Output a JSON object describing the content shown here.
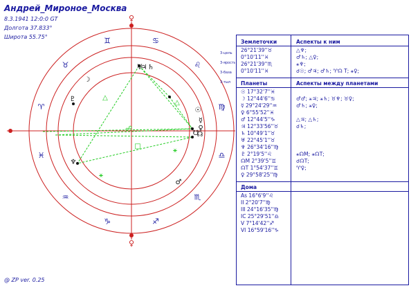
{
  "header": {
    "name": "Андрей_Мироное_Москва",
    "datetime": "8.3.1941 12:0:0 GT",
    "longitude": "Долгота 37.833°",
    "latitude": "Широта 55.75°"
  },
  "footer": {
    "version": "@ ZP  ver. 0.25"
  },
  "wheel": {
    "signs": [
      "♈",
      "♉",
      "♊",
      "♋",
      "♌",
      "♍",
      "♎",
      "♏",
      "♐",
      "♑",
      "♒",
      "♓"
    ],
    "side_labels": [
      "3-цель",
      "3-ярость",
      "3-база",
      "3-тыл"
    ],
    "planet_glyphs": [
      "☉",
      "☽",
      "☿",
      "♀",
      "♂",
      "♃",
      "♄",
      "♅",
      "♆",
      "♇",
      "☊",
      "☋"
    ],
    "aspect_marks": [
      "△",
      "☍",
      "□",
      "⚹",
      "△",
      "⚹"
    ],
    "colors": {
      "ring": "#cc2020",
      "axis": "#cc2020",
      "aspect": "#22cc22",
      "ink": "#1a1aa0"
    }
  },
  "table": {
    "header1": [
      "Землеточки",
      "Аспекты к ним"
    ],
    "points": [
      {
        "pos": "26°21'39''♉",
        "asp": "△♆;"
      },
      {
        "pos": "0°10'11''♓",
        "asp": "♂♄; △♀;"
      },
      {
        "pos": "26°21'39''♏",
        "asp": "⚹♆;"
      },
      {
        "pos": "0°10'11''♓",
        "asp": "☌☉; ♂♃; ♂♄; ♈☊ T; ⚹♀;"
      }
    ],
    "header2": [
      "Планеты",
      "Аспекты между планетами"
    ],
    "planets": [
      {
        "pos": "☉ 17°32'7''♓",
        "asp": ""
      },
      {
        "pos": "☽ 12°44'6''♋",
        "asp": "♂♂; ⚹♃; ⚹♄; ♉♆; ♉♀;"
      },
      {
        "pos": "☿ 29°24'29''♒",
        "asp": "♂♄; ⚹♀;"
      },
      {
        "pos": "♀ 6°55'52''♓",
        "asp": ""
      },
      {
        "pos": "♂ 12°44'5''♑",
        "asp": "△♃; △♄;"
      },
      {
        "pos": "♃ 12°33'56''♉",
        "asp": "☌♄;"
      },
      {
        "pos": "♄ 10°49'1''♉",
        "asp": ""
      },
      {
        "pos": "♅ 22°45'1''♉",
        "asp": ""
      },
      {
        "pos": "♆ 26°34'16''♍",
        "asp": ""
      },
      {
        "pos": "♇ 2°19'5''♌",
        "asp": "⚹☊M; ⚹☊T;"
      },
      {
        "pos": "☊M 2°39'5''♊",
        "asp": "☌☊T;"
      },
      {
        "pos": "☊T 1°54'37''♊",
        "asp": "♈♀;"
      },
      {
        "pos": "♀ 29°58'25''♍",
        "asp": ""
      }
    ],
    "header3": [
      "Дома",
      ""
    ],
    "houses": [
      {
        "pos": "As 16°6'9''♌",
        "asp": ""
      },
      {
        "pos": "II 2°20'7''♍",
        "asp": ""
      },
      {
        "pos": "III 24°16'35''♍",
        "asp": ""
      },
      {
        "pos": "IC 25°29'51''♎",
        "asp": ""
      },
      {
        "pos": "V 7°14'42''♐",
        "asp": ""
      },
      {
        "pos": "VI 16°59'16''♑",
        "asp": ""
      }
    ]
  }
}
